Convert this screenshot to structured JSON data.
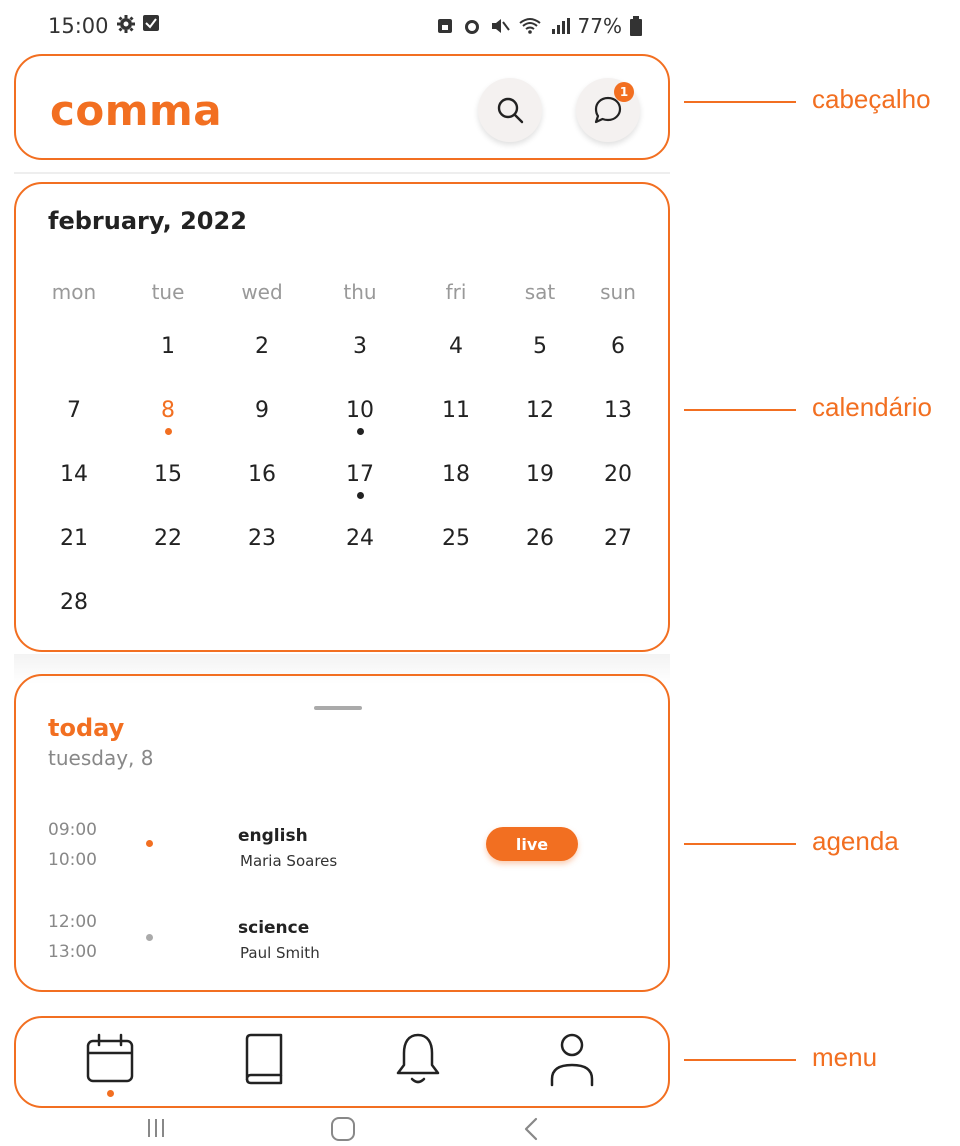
{
  "status_bar": {
    "time": "15:00",
    "battery": "77%",
    "left_icons": [
      "gear-icon",
      "check-box-icon"
    ],
    "right_icons": [
      "lock-icon",
      "alarm-icon",
      "mute-icon",
      "wifi-icon",
      "signal-icon",
      "battery-icon"
    ]
  },
  "header": {
    "brand": "comma",
    "chat_badge": "1"
  },
  "calendar": {
    "month_title": "february, 2022",
    "weekdays": [
      "mon",
      "tue",
      "wed",
      "thu",
      "fri",
      "sat",
      "sun"
    ],
    "weeks": [
      [
        "",
        "1",
        "2",
        "3",
        "4",
        "5",
        "6"
      ],
      [
        "7",
        "8",
        "9",
        "10",
        "11",
        "12",
        "13"
      ],
      [
        "14",
        "15",
        "16",
        "17",
        "18",
        "19",
        "20"
      ],
      [
        "21",
        "22",
        "23",
        "24",
        "25",
        "26",
        "27"
      ],
      [
        "28",
        "",
        "",
        "",
        "",
        "",
        ""
      ]
    ],
    "today": "8",
    "event_days": [
      "8",
      "10",
      "17"
    ]
  },
  "agenda": {
    "title": "today",
    "subtitle": "tuesday, 8",
    "events": [
      {
        "start": "09:00",
        "end": "10:00",
        "subject": "english",
        "teacher": "Maria Soares",
        "status": "live"
      },
      {
        "start": "12:00",
        "end": "13:00",
        "subject": "science",
        "teacher": "Paul Smith",
        "status": ""
      }
    ]
  },
  "bottom_nav": {
    "items": [
      "calendar-icon",
      "book-icon",
      "bell-icon",
      "profile-icon"
    ],
    "active": "calendar-icon"
  },
  "annotations": {
    "header": "cabeçalho",
    "calendar": "calendário",
    "agenda": "agenda",
    "menu": "menu"
  },
  "colors": {
    "accent": "#f26f21",
    "text": "#222222",
    "muted": "#888888"
  }
}
